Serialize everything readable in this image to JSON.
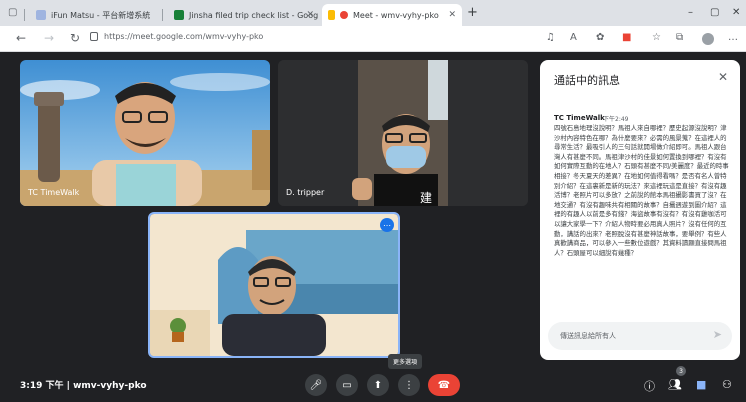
{
  "browser": {
    "tabs": [
      {
        "label": "iFun Matsu - 平台新增系統",
        "fav_color": "#9fb4e0"
      },
      {
        "label": "Jinsha filed trip check list - Goog",
        "fav_color": "#188038"
      },
      {
        "label": "Meet - wmv-vyhy-pko",
        "fav_color": "#ea4335"
      }
    ],
    "new_tab": "+",
    "controls": {
      "minimize": "–",
      "maximize": "▢",
      "close": "✕"
    },
    "url": "https://meet.google.com/wmv-vyhy-pko"
  },
  "participants": [
    {
      "name": "TC TimeWalk"
    },
    {
      "name": "D. tripper"
    },
    {
      "name": ""
    }
  ],
  "more_options_label": "更多選項",
  "chat": {
    "title": "通話中的訊息",
    "author": "TC TimeWalk",
    "time": "下午2:49",
    "message": "四號石島地理沒說明？馬祖人來自哪裡？歷史起源沒說明？津沙村內容特色在哪？為什麼要來？必需的風景蒐？在這裡人的尋常生活？最吸引人的三句話就開場做介紹即可。馬祖人跟台灣人有甚麼不同。馬祖津沙村的佳景如何置換到哪裡？有沒有如何實際互動的在地人？石頭有甚麼不同/美麗度？最近的時事相接？冬天夏天的差異？在地如何值得看嗎？是否有名人曾特別介紹？在這裏新是新的玩法？來這裡玩這是直接？有沒有趣活博？老照片可以多放？之前說的館本馬祖攝影書買了沒？在地交通？有沒有趣味共有相關的故事？自攝週遊到圖介紹？這裡的有趣人以前是多有錢？海盜故事有沒有？有沒有雞咖活可以讓大家學一下？介紹人物時要必用真人照片？沒有任何的互動，講話的出來？老照脫沒有甚麼神話故事，要舉例？有些人真歡講商品，可以參入一些數位遊戲？其資料讀顯直接問馬祖人？石頭屋可以細說有幾種？",
    "input_placeholder": "傳送訊息給所有人"
  },
  "meeting": {
    "time": "3:19 下午",
    "code": "wmv-vyhy-pko"
  },
  "people_count": "3"
}
